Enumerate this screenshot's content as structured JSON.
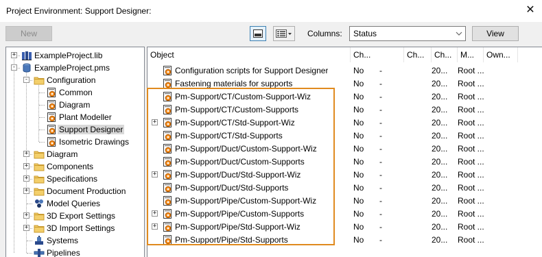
{
  "window": {
    "title": "Project Environment: Support Designer:",
    "close_glyph": "✕"
  },
  "toolbar": {
    "new_label": "New",
    "columns_label": "Columns:",
    "columns_value": "Status",
    "view_label": "View"
  },
  "tree": {
    "items": [
      {
        "label": "ExampleProject.lib",
        "icon": "library-icon"
      },
      {
        "label": "ExampleProject.pms",
        "icon": "project-icon"
      },
      {
        "label": "Configuration",
        "icon": "folder-icon"
      },
      {
        "label": "Common",
        "icon": "config-icon"
      },
      {
        "label": "Diagram",
        "icon": "config-icon"
      },
      {
        "label": "Plant Modeller",
        "icon": "config-icon"
      },
      {
        "label": "Support Designer",
        "icon": "config-icon",
        "selected": true
      },
      {
        "label": "Isometric Drawings",
        "icon": "config-icon"
      },
      {
        "label": "Diagram",
        "icon": "folder-icon"
      },
      {
        "label": "Components",
        "icon": "folder-icon"
      },
      {
        "label": "Specifications",
        "icon": "folder-icon"
      },
      {
        "label": "Document Production",
        "icon": "folder-icon"
      },
      {
        "label": "Model Queries",
        "icon": "queries-icon"
      },
      {
        "label": "3D Export Settings",
        "icon": "folder-icon"
      },
      {
        "label": "3D Import Settings",
        "icon": "folder-icon"
      },
      {
        "label": "Systems",
        "icon": "systems-icon"
      },
      {
        "label": "Pipelines",
        "icon": "pipelines-icon"
      }
    ]
  },
  "grid": {
    "headers": [
      "Object",
      "Ch...",
      "Ch...",
      "Ch...",
      "M...",
      "Own..."
    ],
    "rows": [
      {
        "name": "Configuration scripts for Support Designer",
        "c1": "No",
        "c2": "-",
        "c3": "",
        "m": "20...",
        "own": "Root ...",
        "expandable": false
      },
      {
        "name": "Fastening materials for supports",
        "c1": "No",
        "c2": "-",
        "c3": "",
        "m": "20...",
        "own": "Root ...",
        "expandable": false
      },
      {
        "name": "Pm-Support/CT/Custom-Support-Wiz",
        "c1": "No",
        "c2": "-",
        "c3": "",
        "m": "20...",
        "own": "Root ...",
        "expandable": false
      },
      {
        "name": "Pm-Support/CT/Custom-Supports",
        "c1": "No",
        "c2": "-",
        "c3": "",
        "m": "20...",
        "own": "Root ...",
        "expandable": false
      },
      {
        "name": "Pm-Support/CT/Std-Support-Wiz",
        "c1": "No",
        "c2": "-",
        "c3": "",
        "m": "20...",
        "own": "Root ...",
        "expandable": true
      },
      {
        "name": "Pm-Support/CT/Std-Supports",
        "c1": "No",
        "c2": "-",
        "c3": "",
        "m": "20...",
        "own": "Root ...",
        "expandable": false
      },
      {
        "name": "Pm-Support/Duct/Custom-Support-Wiz",
        "c1": "No",
        "c2": "-",
        "c3": "",
        "m": "20...",
        "own": "Root ...",
        "expandable": false
      },
      {
        "name": "Pm-Support/Duct/Custom-Supports",
        "c1": "No",
        "c2": "-",
        "c3": "",
        "m": "20...",
        "own": "Root ...",
        "expandable": false
      },
      {
        "name": "Pm-Support/Duct/Std-Support-Wiz",
        "c1": "No",
        "c2": "-",
        "c3": "",
        "m": "20...",
        "own": "Root ...",
        "expandable": true
      },
      {
        "name": "Pm-Support/Duct/Std-Supports",
        "c1": "No",
        "c2": "-",
        "c3": "",
        "m": "20...",
        "own": "Root ...",
        "expandable": false
      },
      {
        "name": "Pm-Support/Pipe/Custom-Support-Wiz",
        "c1": "No",
        "c2": "-",
        "c3": "",
        "m": "20...",
        "own": "Root ...",
        "expandable": false
      },
      {
        "name": "Pm-Support/Pipe/Custom-Supports",
        "c1": "No",
        "c2": "-",
        "c3": "",
        "m": "20...",
        "own": "Root ...",
        "expandable": true
      },
      {
        "name": "Pm-Support/Pipe/Std-Support-Wiz",
        "c1": "No",
        "c2": "-",
        "c3": "",
        "m": "20...",
        "own": "Root ...",
        "expandable": true
      },
      {
        "name": "Pm-Support/Pipe/Std-Supports",
        "c1": "No",
        "c2": "-",
        "c3": "",
        "m": "20...",
        "own": "Root ...",
        "expandable": false
      }
    ]
  },
  "colors": {
    "highlight": "#e08a1e",
    "selection": "#d9d9d9",
    "folder": "#e8b94a"
  }
}
